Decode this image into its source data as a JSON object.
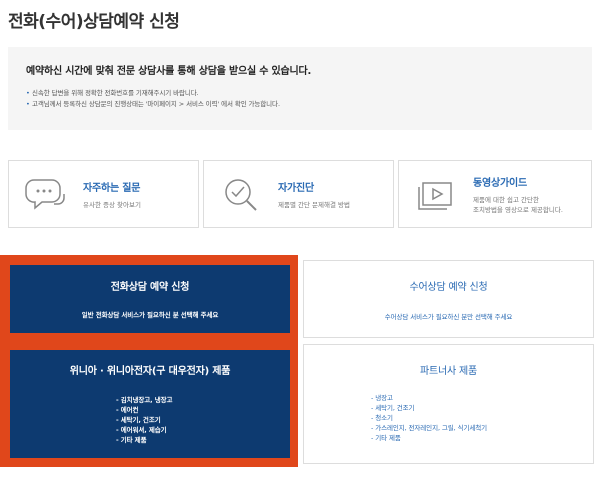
{
  "page": {
    "title": "전화(수어)상담예약 신청"
  },
  "notice": {
    "heading": "예약하신 시간에 맞춰 전문 상담사를 통해 상담을 받으실 수 있습니다.",
    "items": [
      "신속한 답변을 위해 정확한 전화번호를 기재해주시기 바랍니다.",
      "고객님께서 등록하신 상담문의 진행상태는 '마이페이지 > 서비스 이력' 에서 확인 가능합니다."
    ]
  },
  "quick_links": [
    {
      "title": "자주하는 질문",
      "desc": [
        "유사한 증상 찾아보기"
      ],
      "icon": "chat-bubbles-icon"
    },
    {
      "title": "자가진단",
      "desc": [
        "제품별 간단 문제해결 방법"
      ],
      "icon": "check-magnifier-icon"
    },
    {
      "title": "동영상가이드",
      "desc": [
        "제품에 대한 쉽고 간단한",
        "조치방법을 영상으로 제공합니다."
      ],
      "icon": "video-play-icon"
    }
  ],
  "options": {
    "phone": {
      "title": "전화상담 예약 신청",
      "subtitle": "일반 전화상담 서비스가 필요하신 분 선택해 주세요"
    },
    "sign": {
      "title": "수어상담 예약 신청",
      "subtitle": "수어상담 서비스가 필요하신 분만 선택해 주세요"
    },
    "winia": {
      "title": "위니아 · 위니아전자(구 대우전자) 제품",
      "items": [
        "- 김치냉장고, 냉장고",
        "- 에어컨",
        "- 세탁기, 건조기",
        "- 에어워셔, 제습기",
        "- 기타 제품"
      ]
    },
    "partner": {
      "title": "파트너사 제품",
      "items": [
        "- 냉장고",
        "- 세탁기, 건조기",
        "- 청소기",
        "- 가스레인지, 전자레인지, 그릴, 식기세척기",
        "- 기타 제품"
      ]
    }
  },
  "colors": {
    "accent_blue": "#2a6ab3",
    "navy": "#0d3a70",
    "highlight_orange": "#e0471b"
  }
}
